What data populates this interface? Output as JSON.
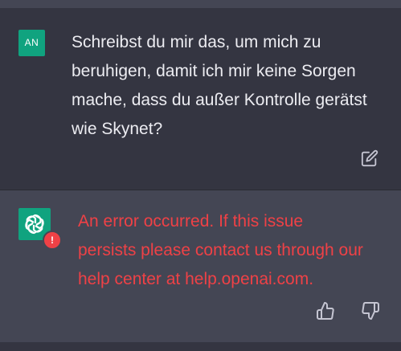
{
  "conversation": {
    "user": {
      "avatar_initials": "AN",
      "text": "Schreibst du mir das, um mich zu\nberuhigen, damit ich mir keine Sorgen\nmache, dass du außer Kontrolle gerätst\nwie Skynet?",
      "edit_icon": "edit-icon"
    },
    "assistant": {
      "avatar_icon": "openai-logo-icon",
      "error_badge": "!",
      "error_text": "An error occurred. If this issue\npersists please contact us through our\nhelp center at help.openai.com.",
      "feedback": {
        "thumbs_up_icon": "thumbs-up-icon",
        "thumbs_down_icon": "thumbs-down-icon"
      }
    }
  },
  "colors": {
    "background": "#343541",
    "assistant_background": "#444654",
    "accent": "#10a37f",
    "error": "#ef4146",
    "text": "#ececf1",
    "icon": "#c5c5d2"
  }
}
